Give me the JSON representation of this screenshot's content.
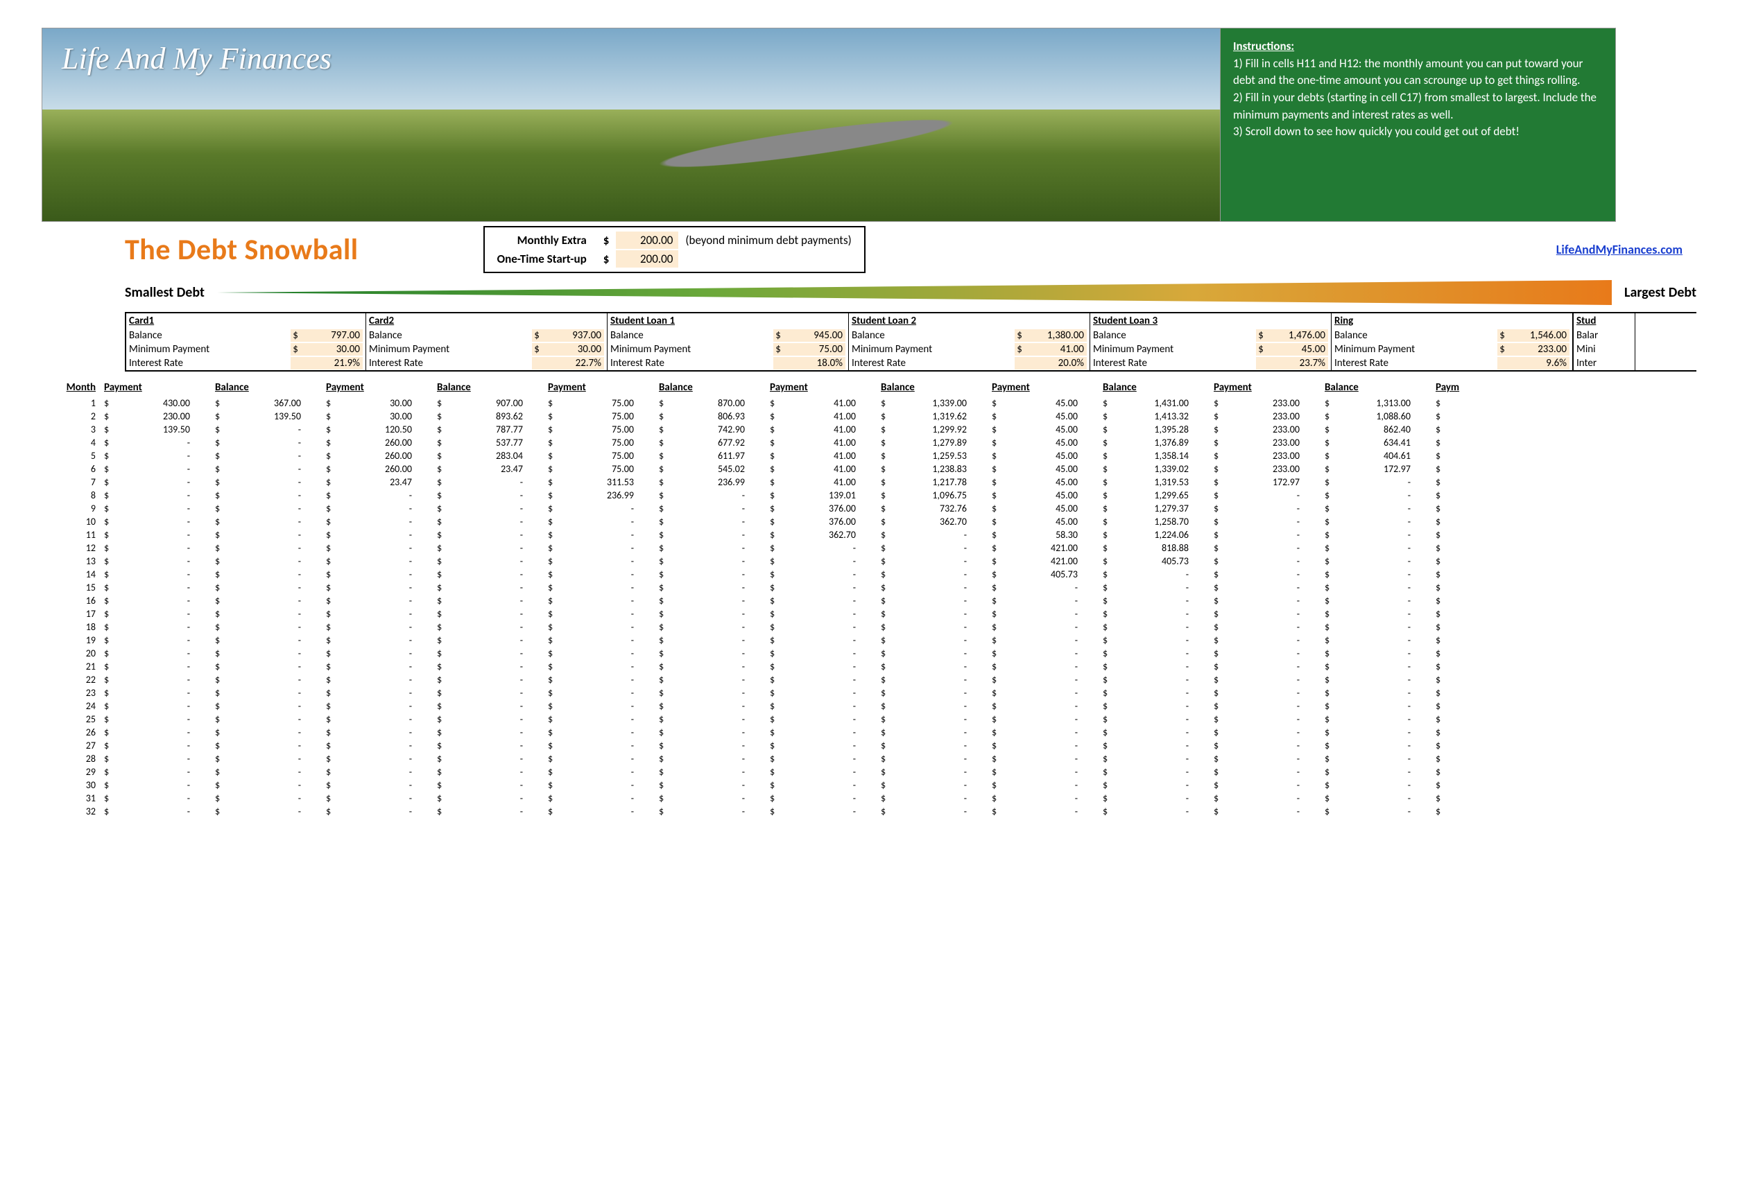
{
  "banner": {
    "brand": "Life And My Finances"
  },
  "instructions": {
    "title": "Instructions:",
    "lines": [
      "1) Fill in cells H11 and H12: the monthly amount you can put toward your debt and the one-time amount you can scrounge up to get things rolling.",
      "2) Fill in your debts (starting in cell C17) from smallest to largest. Include the minimum payments and interest rates as well.",
      "3) Scroll down to see how quickly you could get out of debt!"
    ]
  },
  "title": "The Debt Snowball",
  "inputs": {
    "monthly_label": "Monthly Extra",
    "monthly_value": "200.00",
    "monthly_note": "(beyond minimum debt payments)",
    "startup_label": "One-Time Start-up",
    "startup_value": "200.00"
  },
  "site_link": "LifeAndMyFinances.com",
  "wedge": {
    "left": "Smallest Debt",
    "right": "Largest Debt"
  },
  "debt_labels": {
    "balance": "Balance",
    "min": "Minimum Payment",
    "rate": "Interest Rate"
  },
  "debts": [
    {
      "name": "Card1",
      "balance": "797.00",
      "min": "30.00",
      "rate": "21.9%"
    },
    {
      "name": "Card2",
      "balance": "937.00",
      "min": "30.00",
      "rate": "22.7%"
    },
    {
      "name": "Student Loan 1",
      "balance": "945.00",
      "min": "75.00",
      "rate": "18.0%"
    },
    {
      "name": "Student Loan 2",
      "balance": "1,380.00",
      "min": "41.00",
      "rate": "20.0%"
    },
    {
      "name": "Student Loan 3",
      "balance": "1,476.00",
      "min": "45.00",
      "rate": "23.7%"
    },
    {
      "name": "Ring",
      "balance": "1,546.00",
      "min": "233.00",
      "rate": "9.6%"
    }
  ],
  "debt_partial": {
    "name": "Stud",
    "balance_lbl": "Balar",
    "min_lbl": "Mini",
    "rate_lbl": "Inter"
  },
  "sched_headers": {
    "month": "Month",
    "payment": "Payment",
    "balance": "Balance"
  },
  "partial_header": "Paym",
  "months": 32,
  "schedule": [
    {
      "m": 1,
      "cells": [
        [
          "430.00",
          "367.00"
        ],
        [
          "30.00",
          "907.00"
        ],
        [
          "75.00",
          "870.00"
        ],
        [
          "41.00",
          "1,339.00"
        ],
        [
          "45.00",
          "1,431.00"
        ],
        [
          "233.00",
          "1,313.00"
        ]
      ]
    },
    {
      "m": 2,
      "cells": [
        [
          "230.00",
          "139.50"
        ],
        [
          "30.00",
          "893.62"
        ],
        [
          "75.00",
          "806.93"
        ],
        [
          "41.00",
          "1,319.62"
        ],
        [
          "45.00",
          "1,413.32"
        ],
        [
          "233.00",
          "1,088.60"
        ]
      ]
    },
    {
      "m": 3,
      "cells": [
        [
          "139.50",
          "-"
        ],
        [
          "120.50",
          "787.77"
        ],
        [
          "75.00",
          "742.90"
        ],
        [
          "41.00",
          "1,299.92"
        ],
        [
          "45.00",
          "1,395.28"
        ],
        [
          "233.00",
          "862.40"
        ]
      ]
    },
    {
      "m": 4,
      "cells": [
        [
          "-",
          "-"
        ],
        [
          "260.00",
          "537.77"
        ],
        [
          "75.00",
          "677.92"
        ],
        [
          "41.00",
          "1,279.89"
        ],
        [
          "45.00",
          "1,376.89"
        ],
        [
          "233.00",
          "634.41"
        ]
      ]
    },
    {
      "m": 5,
      "cells": [
        [
          "-",
          "-"
        ],
        [
          "260.00",
          "283.04"
        ],
        [
          "75.00",
          "611.97"
        ],
        [
          "41.00",
          "1,259.53"
        ],
        [
          "45.00",
          "1,358.14"
        ],
        [
          "233.00",
          "404.61"
        ]
      ]
    },
    {
      "m": 6,
      "cells": [
        [
          "-",
          "-"
        ],
        [
          "260.00",
          "23.47"
        ],
        [
          "75.00",
          "545.02"
        ],
        [
          "41.00",
          "1,238.83"
        ],
        [
          "45.00",
          "1,339.02"
        ],
        [
          "233.00",
          "172.97"
        ]
      ]
    },
    {
      "m": 7,
      "cells": [
        [
          "-",
          "-"
        ],
        [
          "23.47",
          "-"
        ],
        [
          "311.53",
          "236.99"
        ],
        [
          "41.00",
          "1,217.78"
        ],
        [
          "45.00",
          "1,319.53"
        ],
        [
          "172.97",
          "-"
        ]
      ]
    },
    {
      "m": 8,
      "cells": [
        [
          "-",
          "-"
        ],
        [
          "-",
          "-"
        ],
        [
          "236.99",
          "-"
        ],
        [
          "139.01",
          "1,096.75"
        ],
        [
          "45.00",
          "1,299.65"
        ],
        [
          "-",
          "-"
        ]
      ]
    },
    {
      "m": 9,
      "cells": [
        [
          "-",
          "-"
        ],
        [
          "-",
          "-"
        ],
        [
          "-",
          "-"
        ],
        [
          "376.00",
          "732.76"
        ],
        [
          "45.00",
          "1,279.37"
        ],
        [
          "-",
          "-"
        ]
      ]
    },
    {
      "m": 10,
      "cells": [
        [
          "-",
          "-"
        ],
        [
          "-",
          "-"
        ],
        [
          "-",
          "-"
        ],
        [
          "376.00",
          "362.70"
        ],
        [
          "45.00",
          "1,258.70"
        ],
        [
          "-",
          "-"
        ]
      ]
    },
    {
      "m": 11,
      "cells": [
        [
          "-",
          "-"
        ],
        [
          "-",
          "-"
        ],
        [
          "-",
          "-"
        ],
        [
          "362.70",
          "-"
        ],
        [
          "58.30",
          "1,224.06"
        ],
        [
          "-",
          "-"
        ]
      ]
    },
    {
      "m": 12,
      "cells": [
        [
          "-",
          "-"
        ],
        [
          "-",
          "-"
        ],
        [
          "-",
          "-"
        ],
        [
          "-",
          "-"
        ],
        [
          "421.00",
          "818.88"
        ],
        [
          "-",
          "-"
        ]
      ]
    },
    {
      "m": 13,
      "cells": [
        [
          "-",
          "-"
        ],
        [
          "-",
          "-"
        ],
        [
          "-",
          "-"
        ],
        [
          "-",
          "-"
        ],
        [
          "421.00",
          "405.73"
        ],
        [
          "-",
          "-"
        ]
      ]
    },
    {
      "m": 14,
      "cells": [
        [
          "-",
          "-"
        ],
        [
          "-",
          "-"
        ],
        [
          "-",
          "-"
        ],
        [
          "-",
          "-"
        ],
        [
          "405.73",
          "-"
        ],
        [
          "-",
          "-"
        ]
      ]
    }
  ]
}
